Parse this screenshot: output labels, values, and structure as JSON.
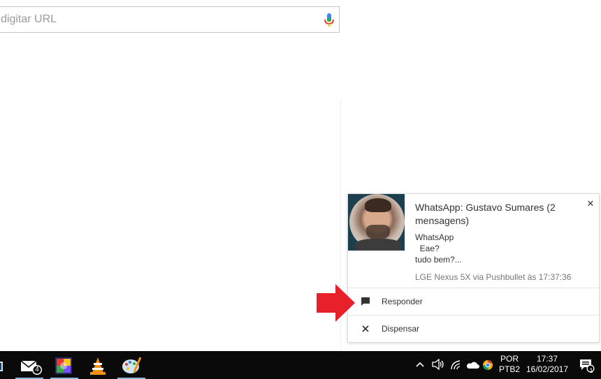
{
  "search": {
    "placeholder": "digitar URL",
    "icon": "mic-icon"
  },
  "notification": {
    "title": "WhatsApp: Gustavo Sumares (2 mensagens)",
    "body_lines": [
      "WhatsApp",
      "  Eae?",
      "tudo bem?..."
    ],
    "source": "LGE Nexus 5X via Pushbullet às 17:37:36",
    "close_icon": "close-icon",
    "actions": [
      {
        "label": "Responder",
        "icon": "comment-icon"
      },
      {
        "label": "Dispensar",
        "icon": "close-icon"
      }
    ]
  },
  "taskbar": {
    "apps": [
      {
        "name": "partial-app",
        "icon": "window-icon"
      },
      {
        "name": "mail",
        "icon": "mail-icon",
        "badge": "4"
      },
      {
        "name": "color-app",
        "icon": "color-tiles-icon"
      },
      {
        "name": "vlc",
        "icon": "vlc-cone-icon"
      },
      {
        "name": "paint",
        "icon": "palette-icon"
      }
    ],
    "tray": {
      "language_top": "POR",
      "language_bottom": "PTB2",
      "time": "17:37",
      "date": "16/02/2017",
      "notifications_count": "1"
    }
  },
  "colors": {
    "arrow": "#e8202a",
    "taskbar": "#0a0a0a",
    "avatar_bg": "#1c3f4f"
  }
}
